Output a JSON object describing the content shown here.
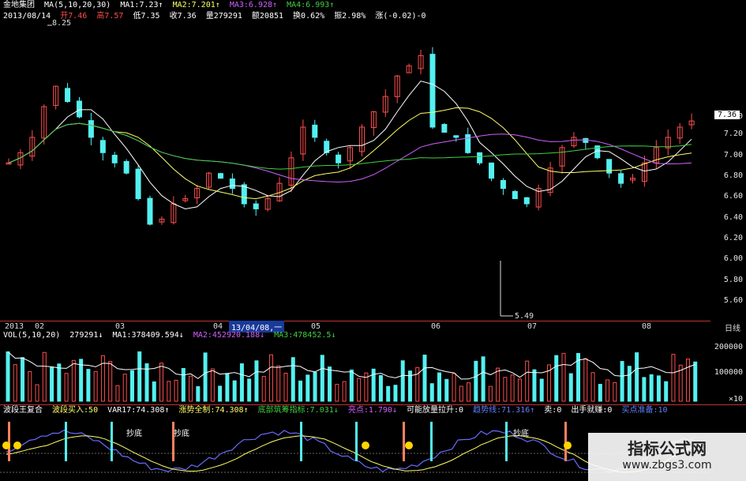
{
  "info_line1": [
    "金地集团",
    "MA(5,10,20,30)",
    "MA1:7.23↑",
    "MA2:7.201↑",
    "MA3:6.928↑",
    "MA4:6.993↑"
  ],
  "info_line2": [
    "2013/08/14",
    "开7.46",
    "高7.57",
    "低7.35",
    "收7.36",
    "量279291",
    "额20851",
    "换0.62%",
    "振2.98%",
    "涨(-0.02)-0"
  ],
  "colors": {
    "up": "#ff4d4d",
    "down": "#54f0f0",
    "ma1": "#ffffff",
    "ma2": "#ffff66",
    "ma3": "#d060ff",
    "ma4": "#40d040",
    "axis": "#b33333",
    "bg": "#000000"
  },
  "price": {
    "high_label": "8.25",
    "low_label": "5.49",
    "last_price": "7.36",
    "y_ticks": [
      "7.40",
      "7.20",
      "7.00",
      "6.80",
      "6.60",
      "6.40",
      "6.20",
      "6.00",
      "5.80",
      "5.60"
    ],
    "date_ticks": [
      "2013",
      "02",
      "03",
      "04",
      "05",
      "06",
      "07",
      "08"
    ],
    "cursor_date": "13/04/08,一",
    "period": "日线"
  },
  "volume": {
    "info": [
      "VOL(5,10,20)",
      "279291↓",
      "MA1:378409.594↓",
      "MA2:452920.188↓",
      "MA3:478452.5↓"
    ],
    "ticks": [
      "200000",
      "100000",
      "×10"
    ]
  },
  "indicator": {
    "info": [
      "波段王复合",
      "波段买入:50",
      "VAR17:74.308↑",
      "涨势全制:74.308↑",
      "底部筑筹指标:7.031↓",
      "亮点:1.790↓",
      "可能放量拉升:0",
      "趋势线:71.316↑",
      "卖:0",
      "出手就赚:0",
      "买点准备:10"
    ],
    "signals": [
      "抄底",
      "抄底",
      "抄底"
    ]
  },
  "watermark": {
    "title": "指标公式网",
    "url": "www.zbgs3.com"
  },
  "chart_data": {
    "type": "candlestick",
    "series": [
      {
        "name": "K",
        "values": [
          6.95,
          7.05,
          7.2,
          7.5,
          7.7,
          7.55,
          7.4,
          7.2,
          7.05,
          6.95,
          6.85,
          6.6,
          6.35,
          6.4,
          6.55,
          6.6,
          6.7,
          6.85,
          6.8,
          6.7,
          6.55,
          6.5,
          6.6,
          6.75,
          7.0,
          7.3,
          7.2,
          7.05,
          6.95,
          7.1,
          7.3,
          7.45,
          7.6,
          7.8,
          7.9,
          8.0,
          7.3,
          7.25,
          7.2,
          7.05,
          6.95,
          6.8,
          6.7,
          6.6,
          6.55,
          6.7,
          6.9,
          7.1,
          7.2,
          7.15,
          7.0,
          6.85,
          6.75,
          6.8,
          6.95,
          7.1,
          7.2,
          7.3,
          7.36
        ]
      }
    ]
  }
}
